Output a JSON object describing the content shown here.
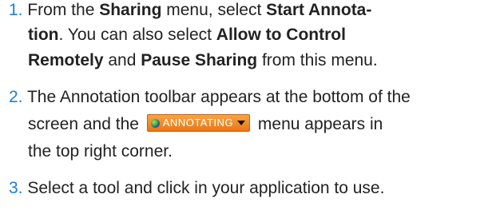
{
  "steps": [
    {
      "number": "1.",
      "lines": [
        [
          "From the ",
          "Sharing",
          " menu, select ",
          "Start Annota-"
        ],
        [
          "tion",
          ". You can also select ",
          "Allow to Control"
        ],
        [
          "Remotely",
          " and ",
          "Pause Sharing",
          " from this menu."
        ]
      ]
    },
    {
      "number": "2.",
      "line1": "The Annotation toolbar appears at the bottom of the",
      "line2_before": "screen and the ",
      "badge_label": "ANNOTATING",
      "line2_after": " menu appears in",
      "line3": "the top right corner."
    },
    {
      "number": "3.",
      "line1": "Select a tool and click in your application to use."
    }
  ],
  "colors": {
    "number": "#1a7fd6",
    "badge": "#e8751a"
  },
  "icons": [
    "globe-icon",
    "chevron-down-icon"
  ]
}
